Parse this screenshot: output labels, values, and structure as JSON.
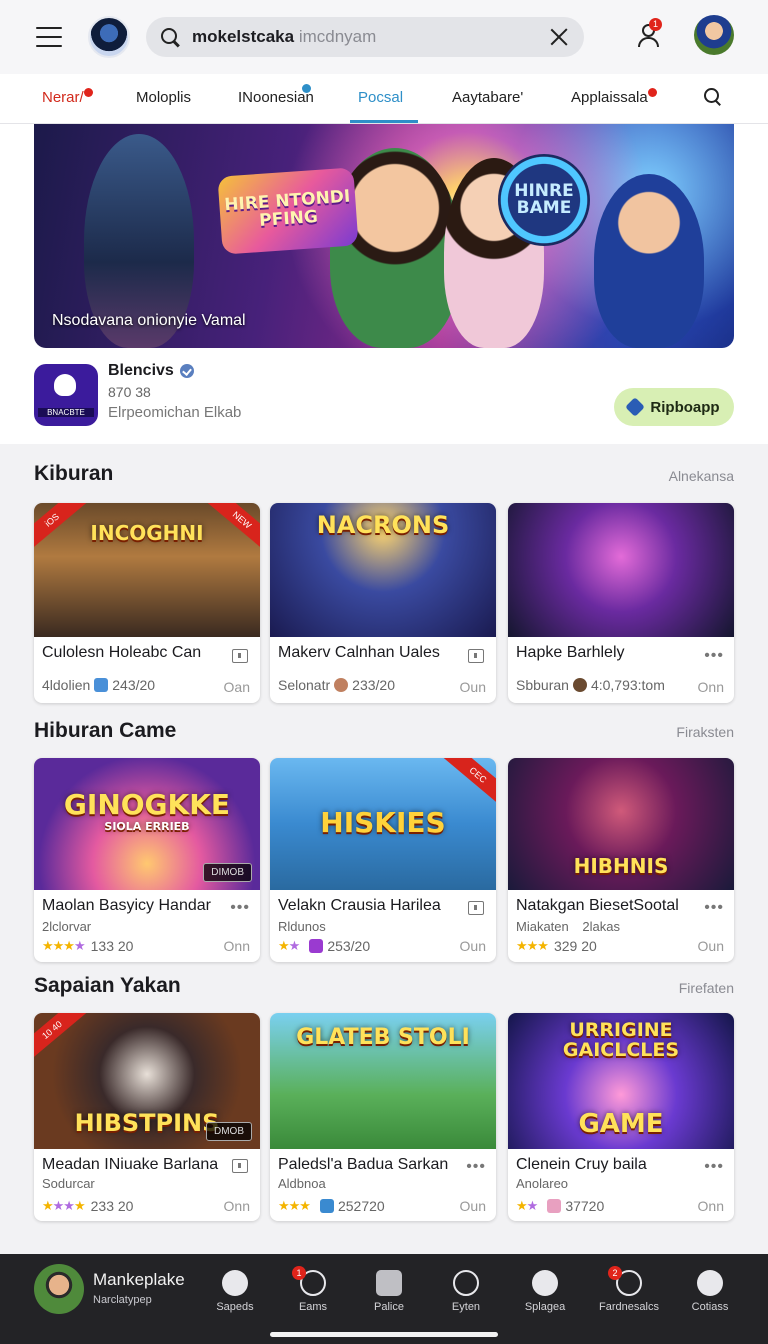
{
  "topbar": {
    "search_query": "mokelstcaka",
    "search_hint": "imcdnyam",
    "notification_count": "1"
  },
  "tabs": [
    {
      "label": "Nerar/"
    },
    {
      "label": "Moloplis"
    },
    {
      "label": "INoonesian"
    },
    {
      "label": "Pocsal"
    },
    {
      "label": "Aaytabare'"
    },
    {
      "label": "Applaissala"
    }
  ],
  "hero": {
    "badge_text": "HIRE NTONDI PFING",
    "circle_text": "HINRE BAME",
    "caption": "Nsodavana onionyie Vamal"
  },
  "app": {
    "name": "Blencivs",
    "meta": "870 38",
    "subtitle": "Elrpeomichan Elkab",
    "icon_label": "BNACBTE",
    "install_label": "Ripboapp"
  },
  "sections": [
    {
      "title": "Kiburan",
      "link": "Alnekansa",
      "cards": [
        {
          "name": "Culolesn Holeabc Can",
          "meta_left": "4ldolien",
          "meta_value": "243/20",
          "right": "Oan",
          "art_title": "INCOGHNI",
          "ribbon": "iOS",
          "ribbon2": "NEW"
        },
        {
          "name": "Makerv Calnhan Uales",
          "meta_left": "Selonatr",
          "meta_value": "233/20",
          "right": "Oun",
          "art_title": "NACRONS"
        },
        {
          "name": "Hapke Barhlely",
          "meta_left": "Sbburan",
          "meta_value": "4:0,793:tom",
          "right": "Onn"
        }
      ]
    },
    {
      "title": "Hiburan Came",
      "link": "Firaksten",
      "cards": [
        {
          "name": "Maolan Basyicy Handar",
          "sub": "2lclorvar",
          "meta_value": "133 20",
          "right": "Onn",
          "art_title": "GINOGKKE",
          "art_sub": "SIOLA ERRIEB",
          "tag": "DIMOB"
        },
        {
          "name": "Velakn Crausia Harilea",
          "sub": "Rldunos",
          "meta_value": "253/20",
          "right": "Oun",
          "art_title": "HISKIES",
          "ribbon": "CEC"
        },
        {
          "name": "Natakgan BiesetSootal",
          "sub": "Miakaten",
          "sub2": "2lakas",
          "meta_value": "329 20",
          "right": "Oun",
          "art_title": "HIBHNIS"
        }
      ]
    },
    {
      "title": "Sapaian Yakan",
      "link": "Firefaten",
      "cards": [
        {
          "name": "Meadan INiuake Barlana",
          "sub": "Sodurcar",
          "meta_value": "233 20",
          "right": "Onn",
          "art_title": "HIBSTPINS",
          "ribbon": "10 40",
          "tag": "DMOB"
        },
        {
          "name": "Paledsl'a Badua Sarkan",
          "sub": "Aldbnoa",
          "meta_value": "252720",
          "right": "Oun",
          "art_title": "GLATEB STOLI"
        },
        {
          "name": "Clenein Cruy baila",
          "sub": "Anolareo",
          "meta_value": "37720",
          "right": "Onn",
          "art_title": "URRIGINE GAICLCLES",
          "art_title2": "GAME"
        }
      ]
    }
  ],
  "bottom_nav": {
    "profile_name": "Mankeplake",
    "profile_sub": "Narclatypep",
    "items": [
      {
        "label": "Sapeds"
      },
      {
        "label": "Eams",
        "badge": "1"
      },
      {
        "label": "Palice"
      },
      {
        "label": "Eyten"
      },
      {
        "label": "Splagea"
      },
      {
        "label": "Fardnesalcs",
        "badge": "2"
      },
      {
        "label": "Cotiass"
      }
    ]
  }
}
